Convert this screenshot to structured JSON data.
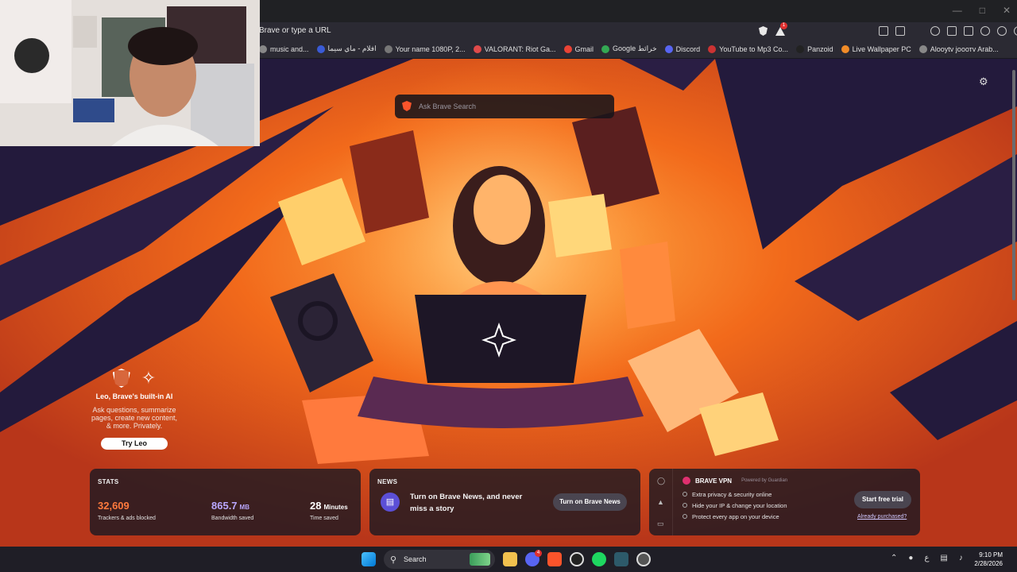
{
  "browser": {
    "url_placeholder": "Brave or type a URL",
    "shields_badge": "1",
    "bookmarks": [
      {
        "label": "music and...",
        "color": "#888888"
      },
      {
        "label": "افلام - ماي سيما",
        "color": "#3a5bd6"
      },
      {
        "label": "Your name 1080P, 2...",
        "color": "#777777"
      },
      {
        "label": "VALORANT: Riot Ga...",
        "color": "#e04a4a"
      },
      {
        "label": "Gmail",
        "color": "#ea4335"
      },
      {
        "label": "Google خرائط",
        "color": "#34a853"
      },
      {
        "label": "Discord",
        "color": "#5865f2"
      },
      {
        "label": "YouTube to Mp3 Co...",
        "color": "#cc3333"
      },
      {
        "label": "Panzoid",
        "color": "#222222"
      },
      {
        "label": "Live Wallpaper PC",
        "color": "#f28c28"
      },
      {
        "label": "Alooytv jooотv Arab...",
        "color": "#888888"
      }
    ]
  },
  "ntp": {
    "search_placeholder": "Ask Brave Search",
    "leo": {
      "title": "Leo, Brave's built-in AI",
      "description": "Ask questions, summarize pages, create new content, & more. Privately.",
      "button": "Try Leo"
    },
    "stats": {
      "label": "STATS",
      "trackers_value": "32,609",
      "trackers_label": "Trackers & ads blocked",
      "trackers_color": "#ff7a3d",
      "bandwidth_value": "865.7",
      "bandwidth_unit": "MB",
      "bandwidth_label": "Bandwidth saved",
      "bandwidth_color": "#b9a7ff",
      "time_value": "28",
      "time_unit": "Minutes",
      "time_label": "Time saved"
    },
    "news": {
      "label": "NEWS",
      "text": "Turn on Brave News, and never miss a story",
      "button": "Turn on Brave News"
    },
    "vpn": {
      "title": "BRAVE VPN",
      "powered": "Powered by Guardian",
      "features": [
        "Extra privacy & security online",
        "Hide your IP & change your location",
        "Protect every app on your device"
      ],
      "button": "Start free trial",
      "link": "Already purchased?"
    }
  },
  "taskbar": {
    "search_label": "Search",
    "discord_badge": "4",
    "lang": "ع",
    "time": "9:10 PM",
    "date": "2/28/2026"
  }
}
